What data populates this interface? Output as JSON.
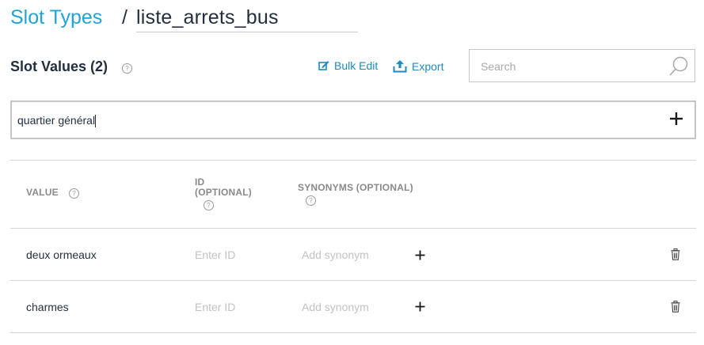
{
  "header": {
    "breadcrumb_link": "Slot Types",
    "separator": "/",
    "slot_type_name": "liste_arrets_bus"
  },
  "section": {
    "title": "Slot Values (2)",
    "help": "?",
    "bulk_edit_label": "Bulk Edit",
    "export_label": "Export",
    "search_placeholder": "Search"
  },
  "new_value": {
    "value": "quartier général"
  },
  "table": {
    "headers": {
      "value": "VALUE",
      "id_line1": "ID",
      "id_line2": "(OPTIONAL)",
      "synonyms": "SYNONYMS (OPTIONAL)"
    },
    "rows": [
      {
        "value": "deux ormeaux",
        "id_placeholder": "Enter ID",
        "synonym_placeholder": "Add synonym"
      },
      {
        "value": "charmes",
        "id_placeholder": "Enter ID",
        "synonym_placeholder": "Add synonym"
      }
    ]
  },
  "colors": {
    "link": "#20a4d6",
    "action": "#1d8ac0",
    "text": "#232f3e",
    "muted": "#8a8a8a",
    "placeholder": "#c2c2c2",
    "border": "#c3c5c9"
  },
  "icons": {
    "help": "question-circle-icon",
    "bulk_edit": "pencil-square-icon",
    "export": "upload-icon",
    "search": "magnifier-icon",
    "add": "plus-icon",
    "delete": "trash-icon"
  }
}
